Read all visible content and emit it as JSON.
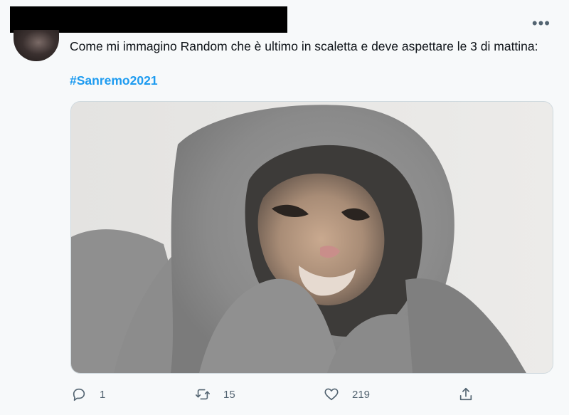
{
  "tweet": {
    "text": "Come mi immagino Random che è ultimo in scaletta e deve aspettare le 3 di mattina:",
    "hashtag": "#Sanremo2021",
    "more_label": "•••"
  },
  "actions": {
    "reply_count": "1",
    "retweet_count": "15",
    "like_count": "219"
  },
  "icons": [
    "more-icon",
    "reply-icon",
    "retweet-icon",
    "like-icon",
    "share-icon"
  ],
  "colors": {
    "hashtag": "#1d9bf0",
    "icon": "#536471"
  }
}
